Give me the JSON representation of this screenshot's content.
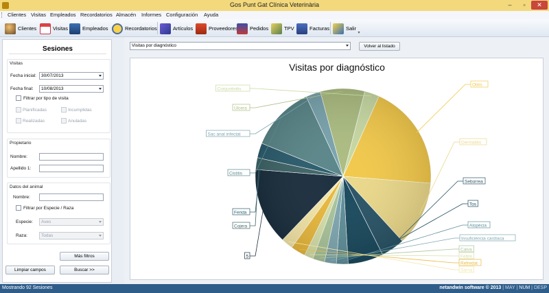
{
  "window": {
    "title": "Gos Punt Gat Clínica Veterinària"
  },
  "menu": [
    "Clientes",
    "Visitas",
    "Empleados",
    "Recordatorios",
    "Almacén",
    "Informes",
    "Configuración",
    "Ayuda"
  ],
  "toolbar": [
    {
      "label": "Clientes",
      "icon": "clients-icon"
    },
    {
      "label": "Visitas",
      "icon": "visits-icon"
    },
    {
      "label": "Empleados",
      "icon": "employees-icon"
    },
    {
      "label": "Recordatorios",
      "icon": "clock-icon"
    },
    {
      "label": "Artículos",
      "icon": "articles-icon"
    },
    {
      "label": "Proveedores",
      "icon": "suppliers-icon"
    },
    {
      "label": "Pedidos",
      "icon": "orders-icon"
    },
    {
      "label": "TPV",
      "icon": "pos-icon"
    },
    {
      "label": "Facturas",
      "icon": "invoices-icon"
    },
    {
      "label": "Salir",
      "icon": "exit-icon"
    }
  ],
  "left": {
    "title": "Sesiones",
    "visits": {
      "group": "Visitas",
      "start_label": "Fecha inicial:",
      "start_value": "30/07/2013",
      "end_label": "Fecha final:",
      "end_value": "10/08/2013",
      "filter_type": "Filtrar por tipo de visita",
      "planned": "Planificadas",
      "unfulfilled": "Incumplidas",
      "done": "Realizadas",
      "cancelled": "Anuladas"
    },
    "owner": {
      "group": "Propietario",
      "name_label": "Nombre:",
      "surname_label": "Apellido 1:"
    },
    "animal": {
      "group": "Datos del animal",
      "name_label": "Nombre:",
      "filter_species": "Filtrar por Especie / Raza",
      "species_label": "Especie:",
      "species_value": "Aves",
      "breed_label": "Raza:",
      "breed_value": "Todas"
    },
    "more_filters": "Más filtros",
    "clear": "Limpiar campos",
    "search": "Buscar  >>"
  },
  "report": {
    "selected": "Visitas por diagnóstico",
    "back": "Volver al listado"
  },
  "chart_data": {
    "type": "pie",
    "title": "Visitas por diagnóstico",
    "slices": [
      {
        "label": "Otitis",
        "value": 18,
        "color": "#f2c94c"
      },
      {
        "label": "Dermatitis",
        "value": 11,
        "color": "#ead88a"
      },
      {
        "label": "Seborrea",
        "value": 4,
        "color": "#2a5466"
      },
      {
        "label": "Tos",
        "value": 6,
        "color": "#1b4a5e"
      },
      {
        "label": "Alopècia",
        "value": 2,
        "color": "#5f8f99"
      },
      {
        "label": "Insuficiència cardíaca",
        "value": 2,
        "color": "#7fa7b0"
      },
      {
        "label": "Calva",
        "value": 2,
        "color": "#a9c49a"
      },
      {
        "label": "Febre",
        "value": 1.5,
        "color": "#d6dfa8"
      },
      {
        "label": "Refredat",
        "value": 2.5,
        "color": "#e9b93e"
      },
      {
        "label": "Sarna",
        "value": 2,
        "color": "#f4e6a8"
      },
      {
        "label": "5",
        "value": 13,
        "color": "#1c2f3f"
      },
      {
        "label": "Cojera",
        "value": 2,
        "color": "#3f6568"
      },
      {
        "label": "Ferida",
        "value": 2.5,
        "color": "#2c5d6e"
      },
      {
        "label": "Cistitis",
        "value": 11,
        "color": "#5b878a"
      },
      {
        "label": "Sac anal infectat",
        "value": 2.5,
        "color": "#7aa4ae"
      },
      {
        "label": "Úlcera",
        "value": 7.5,
        "color": "#acbd82"
      },
      {
        "label": "Conjuntivitis",
        "value": 2.5,
        "color": "#c8d9a3"
      }
    ]
  },
  "status": {
    "left": "Mostrando 92 Sesiones",
    "brand": "netandwin software © 2013",
    "keys": [
      "MAY",
      "NUM",
      "DESP"
    ]
  }
}
